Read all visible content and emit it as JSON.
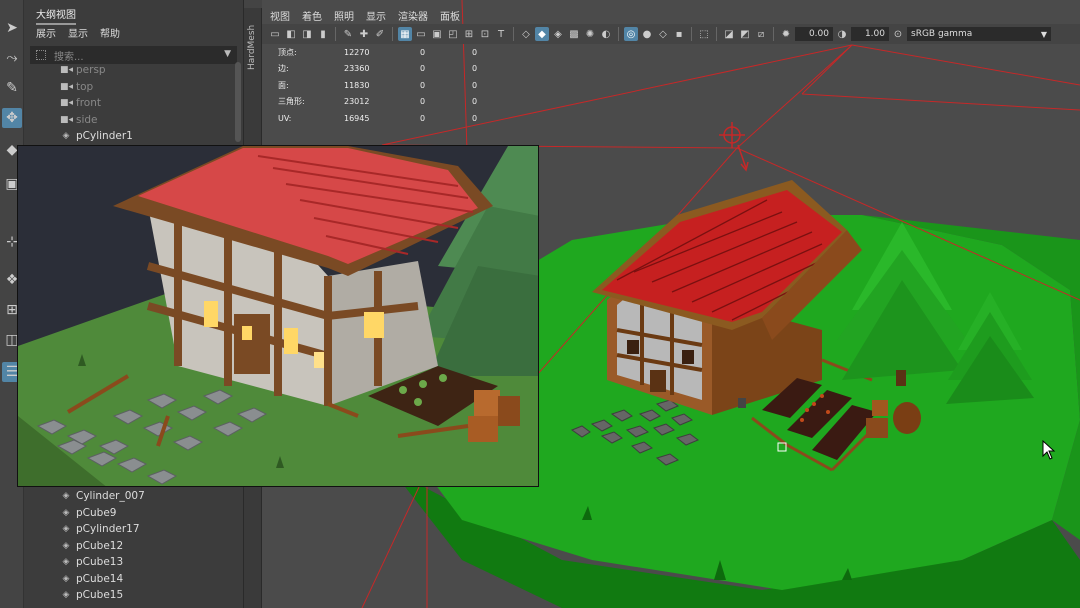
{
  "outliner": {
    "title": "大纲视图",
    "menu": [
      "展示",
      "显示",
      "帮助"
    ],
    "search_placeholder": "搜索...",
    "items_top": [
      {
        "label": "persp",
        "type": "camera"
      },
      {
        "label": "top",
        "type": "camera"
      },
      {
        "label": "front",
        "type": "camera"
      },
      {
        "label": "side",
        "type": "camera"
      },
      {
        "label": "pCylinder1",
        "type": "mesh"
      }
    ],
    "items_bottom": [
      {
        "label": "Cylinder_007",
        "type": "mesh"
      },
      {
        "label": "pCube9",
        "type": "mesh"
      },
      {
        "label": "pCylinder17",
        "type": "mesh"
      },
      {
        "label": "pCube12",
        "type": "mesh"
      },
      {
        "label": "pCube13",
        "type": "mesh"
      },
      {
        "label": "pCube14",
        "type": "mesh"
      },
      {
        "label": "pCube15",
        "type": "mesh"
      }
    ]
  },
  "side_tab": "HardMesh",
  "viewport": {
    "menu": [
      "视图",
      "着色",
      "照明",
      "显示",
      "渲染器",
      "面板"
    ],
    "exposure": "0.00",
    "gamma_value": "1.00",
    "color_space": "sRGB gamma",
    "stats": [
      {
        "label": "顶点:",
        "v1": "12270",
        "v2": "0",
        "v3": "0"
      },
      {
        "label": "边:",
        "v1": "23360",
        "v2": "0",
        "v3": "0"
      },
      {
        "label": "面:",
        "v1": "11830",
        "v2": "0",
        "v3": "0"
      },
      {
        "label": "三角形:",
        "v1": "23012",
        "v2": "0",
        "v3": "0"
      },
      {
        "label": "UV:",
        "v1": "16945",
        "v2": "0",
        "v3": "0"
      }
    ]
  },
  "colors": {
    "accent": "#5285a6",
    "grass": "#1fa81f",
    "roof": "#b71c1c",
    "wood": "#8a4a1c"
  }
}
